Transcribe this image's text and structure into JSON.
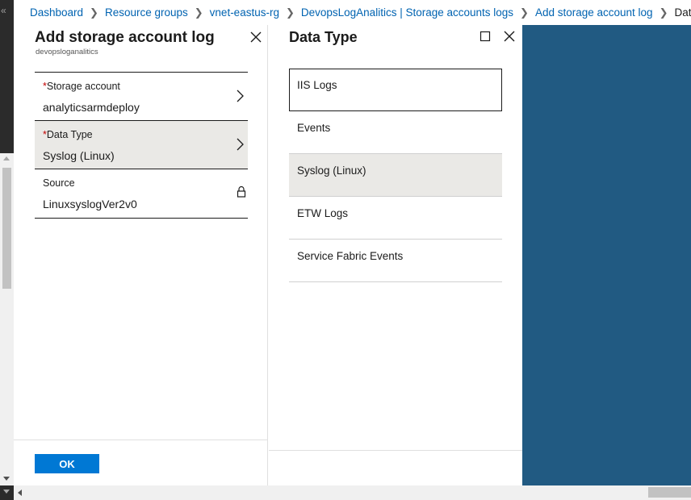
{
  "breadcrumb": {
    "items": [
      {
        "label": "Dashboard"
      },
      {
        "label": "Resource groups"
      },
      {
        "label": "vnet-eastus-rg"
      },
      {
        "label": "DevopsLogAnalitics | Storage accounts logs"
      },
      {
        "label": "Add storage account log"
      }
    ],
    "current": "Data Type"
  },
  "blade_add": {
    "title": "Add storage account log",
    "subtitle": "devopsloganalitics",
    "fields": [
      {
        "required": "*",
        "label": "Storage account",
        "value": "analyticsarmdeploy"
      },
      {
        "required": "*",
        "label": "Data Type",
        "value": "Syslog (Linux)"
      },
      {
        "label": "Source",
        "value": "LinuxsyslogVer2v0"
      }
    ],
    "ok_label": "OK"
  },
  "blade_datatype": {
    "title": "Data Type",
    "items": [
      {
        "label": "IIS Logs"
      },
      {
        "label": "Events"
      },
      {
        "label": "Syslog (Linux)"
      },
      {
        "label": "ETW Logs"
      },
      {
        "label": "Service Fabric Events"
      }
    ]
  },
  "colors": {
    "link": "#0063b1",
    "primary_button": "#0078d4",
    "selected_row": "#eae9e6",
    "required_marker": "#c00000",
    "portal_backdrop": "#215a82"
  },
  "icons": {
    "collapse": "«"
  }
}
